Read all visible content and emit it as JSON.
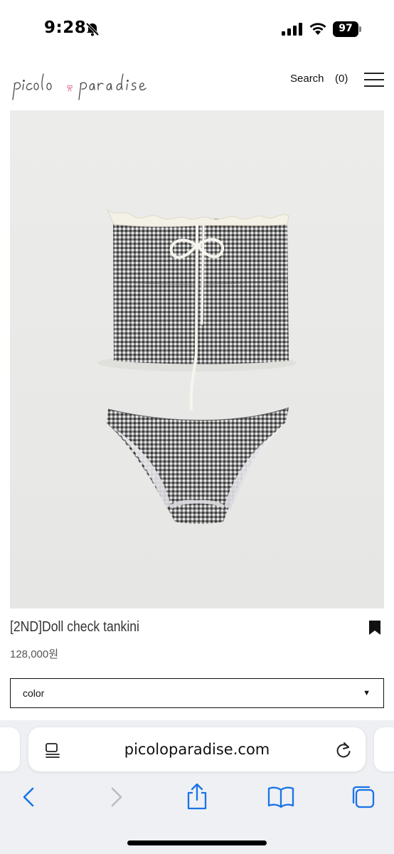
{
  "status_bar": {
    "time": "9:28",
    "battery_level": "97",
    "icons": [
      "bell-slash-icon",
      "cellular-signal-icon",
      "wifi-icon",
      "battery-icon"
    ]
  },
  "header": {
    "logo_text": "picolo paradise",
    "search_label": "Search",
    "cart_label": "(0)",
    "menu_icon": "hamburger-menu-icon"
  },
  "product": {
    "title": "[2ND]Doll check tankini",
    "price": "128,000원",
    "bookmark_icon": "bookmark-icon",
    "image_colors": {
      "background": "#e9e9e7",
      "fabric": "#6d6d6d",
      "trim": "#f4f1e6"
    }
  },
  "options": {
    "color_select_label": "color",
    "select_arrow": "▼"
  },
  "browser": {
    "url": "picoloparadise.com",
    "toolbar_icons": [
      "back-icon",
      "forward-icon",
      "share-icon",
      "bookmarks-icon",
      "tabs-icon"
    ],
    "accent_color": "#1a73e8"
  }
}
